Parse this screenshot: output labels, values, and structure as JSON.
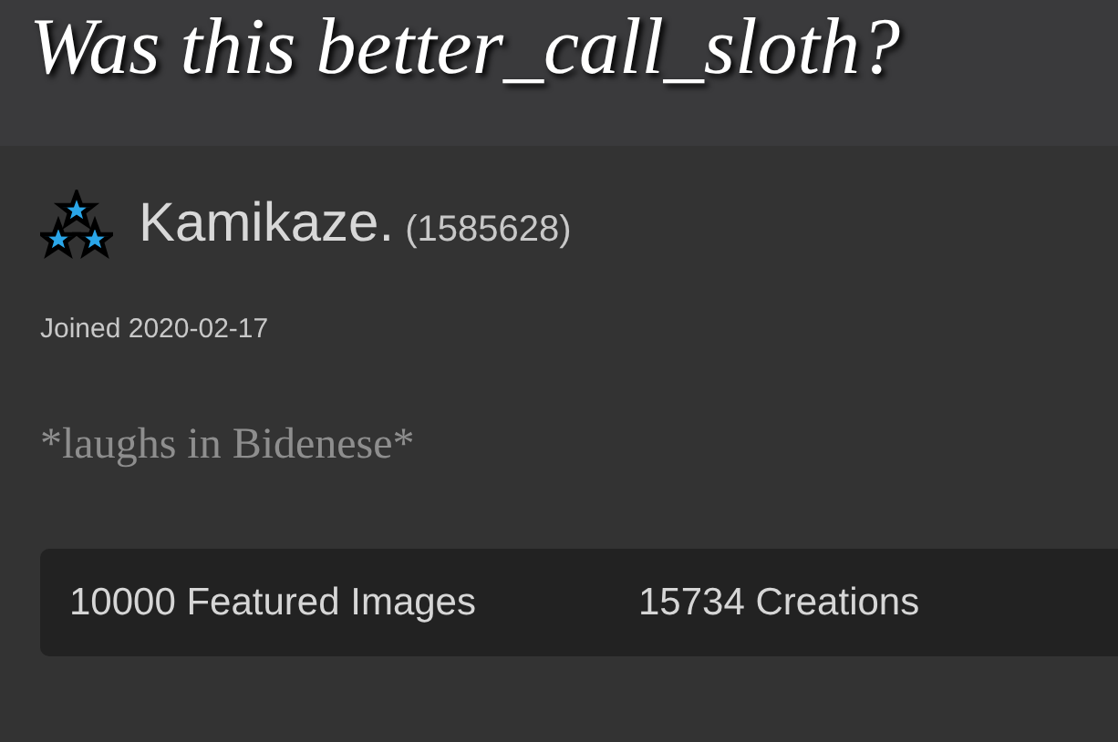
{
  "caption": "Was this better_call_sloth?",
  "profile": {
    "username": "Kamikaze.",
    "points": "(1585628)",
    "joined": "Joined 2020-02-17",
    "bio": "*laughs in Bidenese*"
  },
  "stats": [
    "10000 Featured Images",
    "15734 Creations"
  ]
}
